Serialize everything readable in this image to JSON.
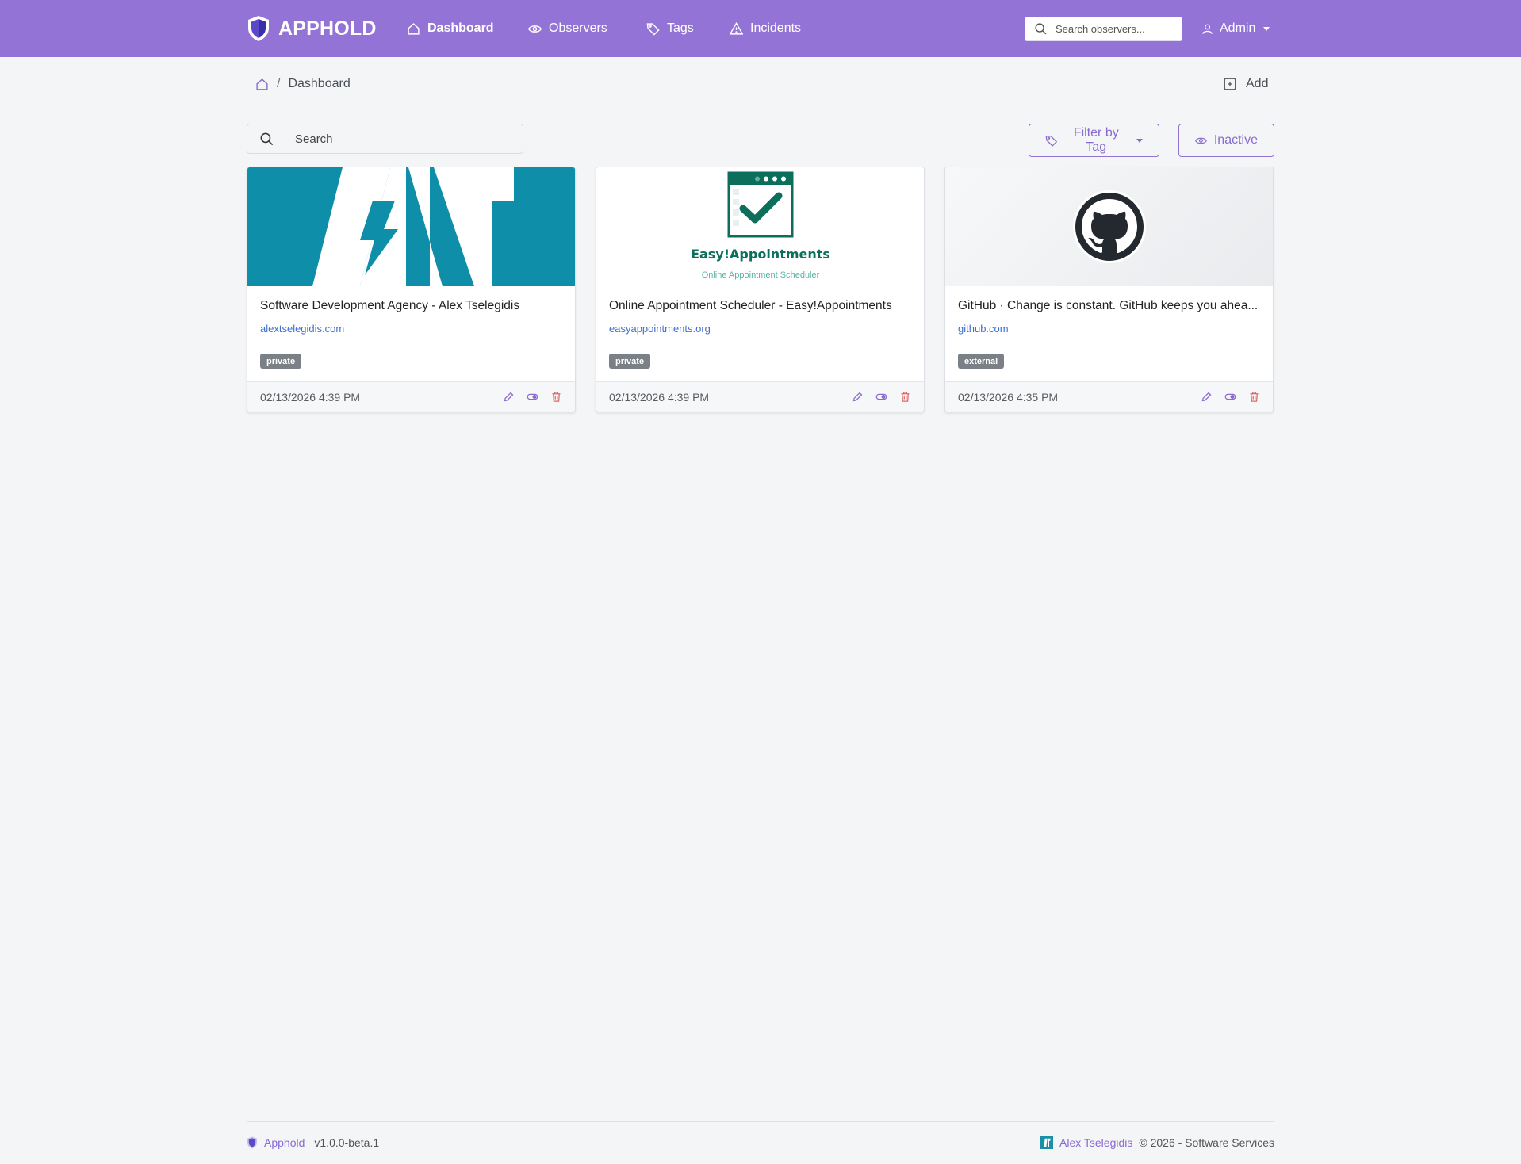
{
  "nav": {
    "brand": "APPHOLD",
    "items": [
      {
        "label": "Dashboard",
        "icon": "home-icon"
      },
      {
        "label": "Observers",
        "icon": "eye-icon"
      },
      {
        "label": "Tags",
        "icon": "tag-icon"
      },
      {
        "label": "Incidents",
        "icon": "warning-icon"
      }
    ],
    "search_placeholder": "Search observers...",
    "user": "Admin"
  },
  "breadcrumb": {
    "current": "Dashboard",
    "separator": "/"
  },
  "toolbar": {
    "add_label": "Add",
    "search_placeholder": "Search",
    "filter_label": "Filter by Tag",
    "inactive_label": "Inactive"
  },
  "cards": [
    {
      "title": "Software Development Agency - Alex Tselegidis",
      "url": "alextselegidis.com",
      "tag": "private",
      "date": "02/13/2026 4:39 PM"
    },
    {
      "title": "Online Appointment Scheduler - Easy!Appointments",
      "url": "easyappointments.org",
      "tag": "private",
      "date": "02/13/2026 4:39 PM",
      "logo_title": "Easy!Appointments",
      "logo_subtitle": "Online Appointment Scheduler"
    },
    {
      "title": "GitHub · Change is constant. GitHub keeps you ahea...",
      "url": "github.com",
      "tag": "external",
      "date": "02/13/2026 4:35 PM"
    }
  ],
  "colors": {
    "navbar": "#9473d6",
    "accent": "#8a6ad0",
    "link": "#3d6fd1",
    "tag_bg": "#7b8087",
    "delete": "#e06666",
    "teal": "#0f8ea9",
    "ea_green": "#0b6f5b"
  },
  "footer": {
    "brand": "Apphold",
    "version": "v1.0.0-beta.1",
    "author": "Alex Tselegidis",
    "copyright": "© 2026 - Software Services"
  }
}
